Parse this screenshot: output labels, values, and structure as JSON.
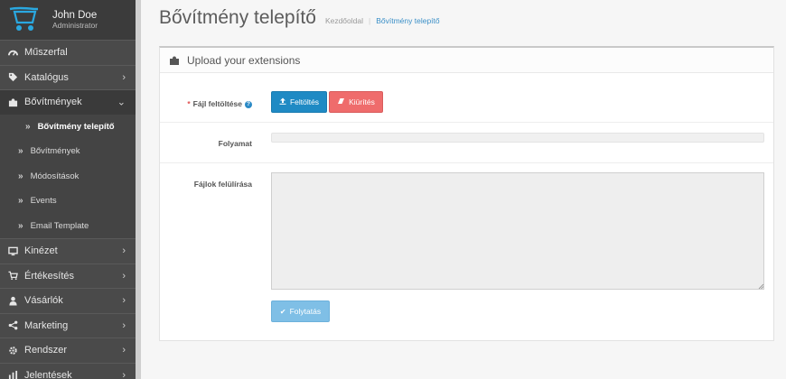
{
  "user": {
    "name": "John Doe",
    "role": "Administrator"
  },
  "sidebar": {
    "items": [
      {
        "label": "Műszerfal",
        "icon": "dashboard-icon",
        "chevron": false
      },
      {
        "label": "Katalógus",
        "icon": "tag-icon",
        "chevron": true
      },
      {
        "label": "Bővítmények",
        "icon": "puzzle-icon",
        "chevron": true,
        "active": true
      },
      {
        "label": "Kinézet",
        "icon": "desktop-icon",
        "chevron": true
      },
      {
        "label": "Értékesítés",
        "icon": "cart-icon",
        "chevron": true
      },
      {
        "label": "Vásárlók",
        "icon": "user-icon",
        "chevron": true
      },
      {
        "label": "Marketing",
        "icon": "share-icon",
        "chevron": true
      },
      {
        "label": "Rendszer",
        "icon": "cog-icon",
        "chevron": true
      },
      {
        "label": "Jelentések",
        "icon": "bar-chart-icon",
        "chevron": true
      }
    ],
    "subitems": [
      {
        "label": "Bővítmény telepítő",
        "current": true
      },
      {
        "label": "Bővítmények"
      },
      {
        "label": "Módosítások"
      },
      {
        "label": "Events"
      },
      {
        "label": "Email Template"
      }
    ]
  },
  "header": {
    "title": "Bővítmény telepítő",
    "breadcrumb": [
      "Kezdőoldal",
      "Bővítmény telepítő"
    ]
  },
  "panel": {
    "title": "Upload your extensions",
    "file_label": "Fájl feltöltése",
    "upload_button": "Feltöltés",
    "clear_button": "Kiürítés",
    "progress_label": "Folyamat",
    "progress_value": 0,
    "overwrite_label": "Fájlok felülírása",
    "overwrite_value": "",
    "continue_button": "Folytatás"
  },
  "colors": {
    "sidebar_bg": "#4a4a4a",
    "primary": "#1f8ac4",
    "danger": "#ef6c6c",
    "info_disabled": "#7fbfe6",
    "link": "#3a8fc7"
  }
}
